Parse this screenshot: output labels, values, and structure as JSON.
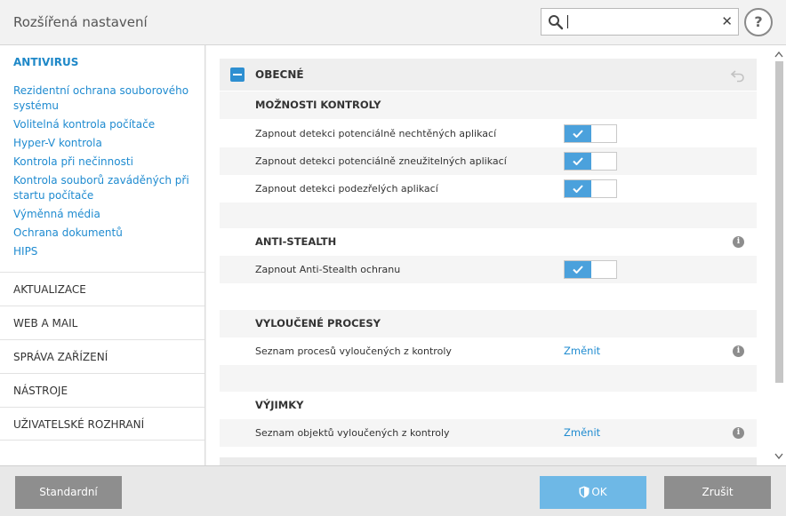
{
  "window": {
    "title": "Rozšířená nastavení"
  },
  "search": {
    "value": "",
    "placeholder": ""
  },
  "sidebar": {
    "section_title": "ANTIVIRUS",
    "links": [
      "Rezidentní ochrana souborového systému",
      "Volitelná kontrola počítače",
      "Hyper-V kontrola",
      "Kontrola při nečinnosti",
      "Kontrola souborů zaváděných při startu počítače",
      "Výměnná média",
      "Ochrana dokumentů",
      "HIPS"
    ],
    "categories": [
      "AKTUALIZACE",
      "WEB A MAIL",
      "SPRÁVA ZAŘÍZENÍ",
      "NÁSTROJE",
      "UŽIVATELSKÉ ROZHRANÍ"
    ]
  },
  "panel": {
    "title": "OBECNÉ",
    "groups": {
      "scan_options": {
        "title": "MOŽNOSTI KONTROLY",
        "rows": [
          {
            "label": "Zapnout detekci potenciálně nechtěných aplikací",
            "enabled": true
          },
          {
            "label": "Zapnout detekci potenciálně zneužitelných aplikací",
            "enabled": true
          },
          {
            "label": "Zapnout detekci podezřelých aplikací",
            "enabled": true
          }
        ]
      },
      "anti_stealth": {
        "title": "ANTI-STEALTH",
        "rows": [
          {
            "label": "Zapnout Anti-Stealth ochranu",
            "enabled": true
          }
        ]
      },
      "excluded_processes": {
        "title": "VYLOUČENÉ PROCESY",
        "row_label": "Seznam procesů vyloučených z kontroly",
        "link": "Změnit"
      },
      "exclusions": {
        "title": "VÝJIMKY",
        "row_label": "Seznam objektů vyloučených z kontroly",
        "link": "Změnit"
      }
    }
  },
  "footer": {
    "default_label": "Standardní",
    "ok_label": "OK",
    "cancel_label": "Zrušit"
  },
  "colors": {
    "accent": "#1f8bd0",
    "toggle_on": "#4ba1dc",
    "ok_button": "#6eb8e6",
    "gray_button": "#8e8e8e"
  },
  "icons": {
    "search": "search-icon",
    "clear": "close-icon",
    "help": "help-icon",
    "collapse": "minus-icon",
    "undo": "undo-icon",
    "info": "info-icon",
    "shield": "shield-icon"
  }
}
